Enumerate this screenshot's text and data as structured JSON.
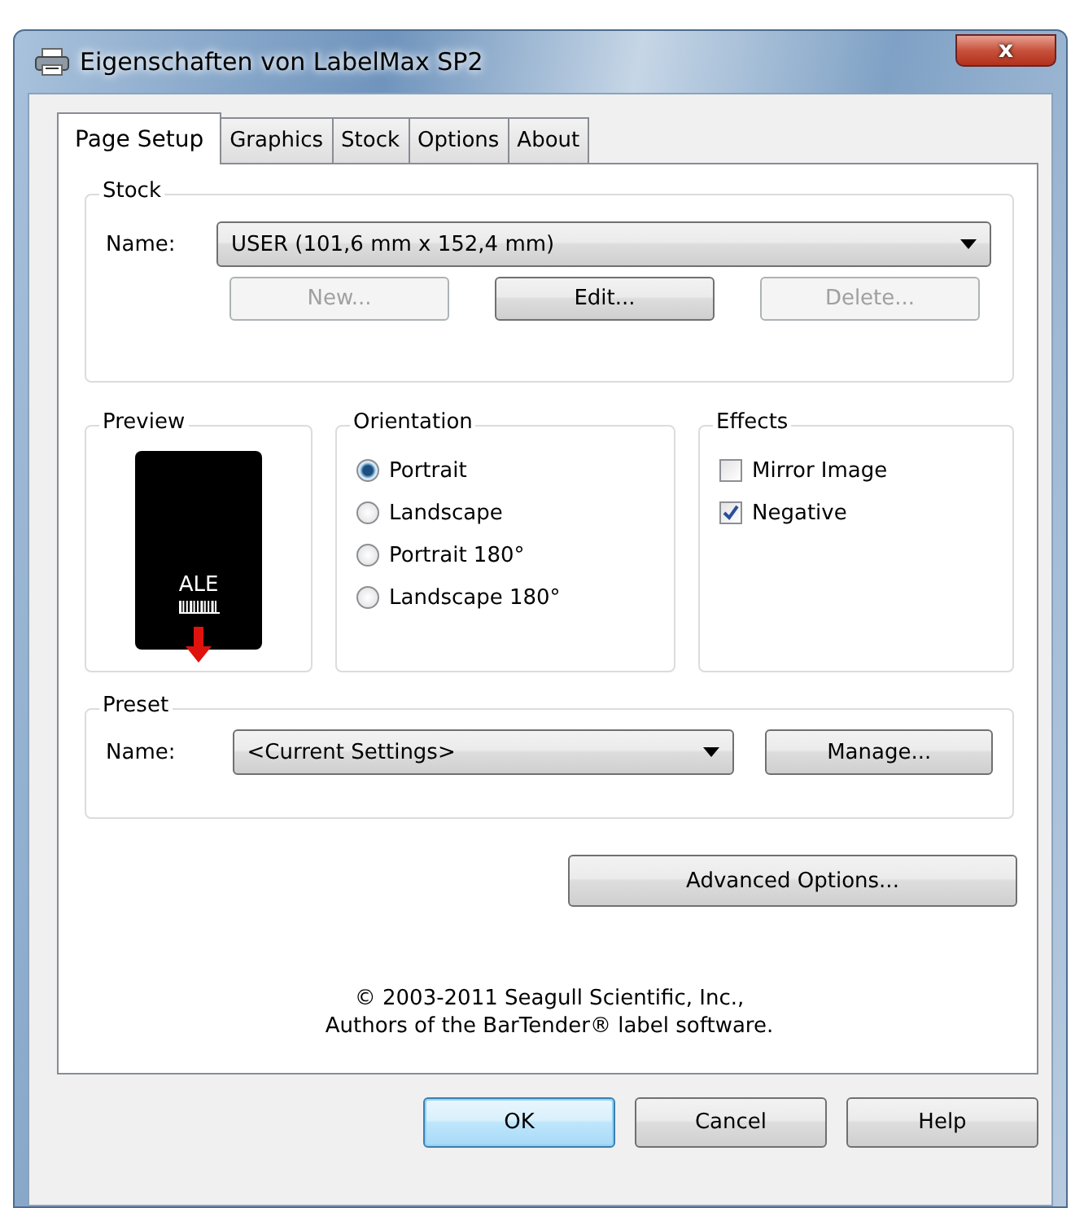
{
  "window": {
    "title": "Eigenschaften von LabelMax SP2",
    "close": "x"
  },
  "tabs": [
    {
      "label": "Page Setup",
      "selected": true
    },
    {
      "label": "Graphics",
      "selected": false
    },
    {
      "label": "Stock",
      "selected": false
    },
    {
      "label": "Options",
      "selected": false
    },
    {
      "label": "About",
      "selected": false
    }
  ],
  "stock": {
    "label": "Stock",
    "name_label": "Name:",
    "value": "USER (101,6 mm x 152,4 mm)",
    "buttons": [
      {
        "label": "New...",
        "disabled": true
      },
      {
        "label": "Edit...",
        "disabled": false
      },
      {
        "label": "Delete...",
        "disabled": true
      }
    ]
  },
  "preview": {
    "label": "Preview",
    "sample_text": "ALE"
  },
  "orientation": {
    "label": "Orientation",
    "options": [
      {
        "label": "Portrait",
        "selected": true
      },
      {
        "label": "Landscape",
        "selected": false
      },
      {
        "label": "Portrait 180°",
        "selected": false
      },
      {
        "label": "Landscape 180°",
        "selected": false
      }
    ]
  },
  "effects": {
    "label": "Effects",
    "options": [
      {
        "label": "Mirror Image",
        "checked": false
      },
      {
        "label": "Negative",
        "checked": true
      }
    ]
  },
  "preset": {
    "label": "Preset",
    "name_label": "Name:",
    "value": "<Current Settings>",
    "button": "Manage..."
  },
  "advanced_button": "Advanced Options...",
  "copyright": [
    "© 2003-2011 Seagull Scientific, Inc.,",
    "Authors of the BarTender® label software."
  ],
  "buttons": [
    {
      "label": "OK",
      "default": true
    },
    {
      "label": "Cancel",
      "default": false
    },
    {
      "label": "Help",
      "default": false
    }
  ]
}
